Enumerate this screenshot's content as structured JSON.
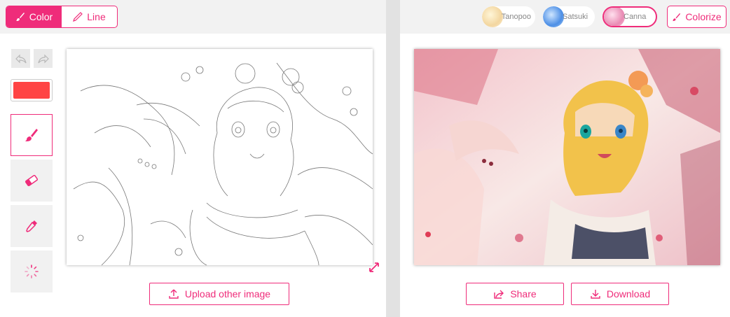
{
  "toolbar": {
    "mode_color_label": "Color",
    "mode_line_label": "Line",
    "active_mode": "Color"
  },
  "styles": {
    "items": [
      {
        "label": "Tanopoo",
        "selected": false
      },
      {
        "label": "Satsuki",
        "selected": false
      },
      {
        "label": "Canna",
        "selected": true
      }
    ],
    "colorize_label": "Colorize"
  },
  "tools": {
    "current_color": "#ff4444",
    "active_tool": "brush",
    "items": [
      "brush-icon",
      "eraser-icon",
      "eyedropper-icon",
      "loading-spinner-icon"
    ]
  },
  "actions": {
    "upload_label": "Upload other image",
    "share_label": "Share",
    "download_label": "Download"
  },
  "theme": {
    "accent": "#ef2c7a"
  }
}
